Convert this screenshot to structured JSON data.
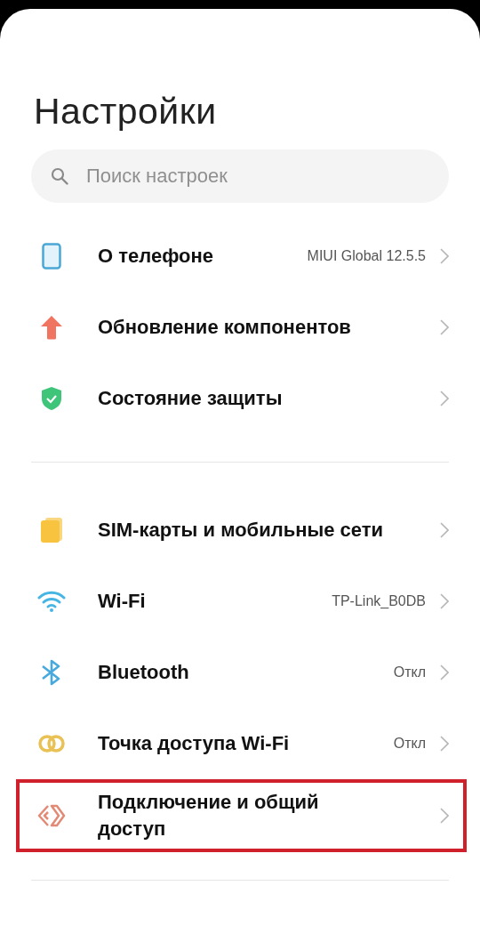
{
  "title": "Настройки",
  "search": {
    "placeholder": "Поиск настроек"
  },
  "groups": [
    {
      "items": [
        {
          "kind": "phone",
          "label": "О телефоне",
          "value": "MIUI Global 12.5.5",
          "highlighted": false
        },
        {
          "kind": "update",
          "label": "Обновление компонентов",
          "highlighted": false
        },
        {
          "kind": "shield",
          "label": "Состояние защиты",
          "highlighted": false
        }
      ]
    },
    {
      "items": [
        {
          "kind": "sim",
          "label": "SIM-карты и мобильные сети",
          "highlighted": false
        },
        {
          "kind": "wifi",
          "label": "Wi-Fi",
          "value": "TP-Link_B0DB",
          "highlighted": false
        },
        {
          "kind": "bluetooth",
          "label": "Bluetooth",
          "value": "Откл",
          "highlighted": false
        },
        {
          "kind": "hotspot",
          "label": "Точка доступа Wi-Fi",
          "value": "Откл",
          "highlighted": false
        },
        {
          "kind": "connection",
          "label": "Подключение и общий доступ",
          "highlighted": true
        }
      ]
    }
  ]
}
